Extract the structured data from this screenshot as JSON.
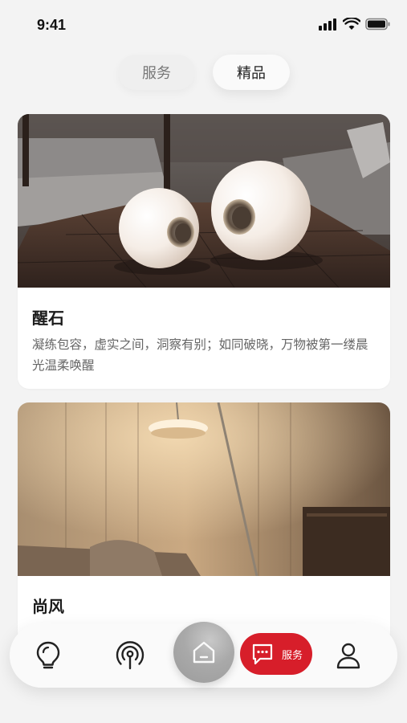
{
  "status": {
    "time": "9:41"
  },
  "tabs": [
    {
      "label": "服务",
      "active": false
    },
    {
      "label": "精品",
      "active": true
    }
  ],
  "cards": [
    {
      "title": "醒石",
      "description": "凝练包容，虚实之间，洞察有别；如同破晓，万物被第一缕晨光温柔唤醒"
    },
    {
      "title": "尚风"
    }
  ],
  "nav": {
    "items": [
      {
        "icon": "lightbulb-icon"
      },
      {
        "icon": "signal-icon"
      },
      {
        "icon": "home-icon"
      },
      {
        "icon": "chat-icon",
        "label": "服务"
      },
      {
        "icon": "user-icon"
      }
    ],
    "accent": "#d71e2a"
  }
}
